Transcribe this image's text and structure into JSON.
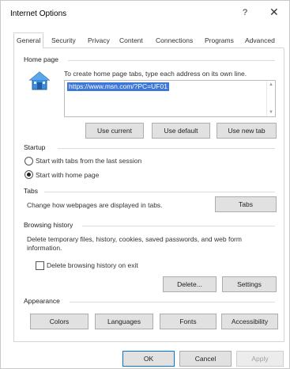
{
  "window": {
    "title": "Internet Options",
    "help_glyph": "?",
    "close_glyph": "✕"
  },
  "tabs": [
    {
      "label": "General",
      "active": true
    },
    {
      "label": "Security"
    },
    {
      "label": "Privacy"
    },
    {
      "label": "Content"
    },
    {
      "label": "Connections"
    },
    {
      "label": "Programs"
    },
    {
      "label": "Advanced"
    }
  ],
  "home_page": {
    "group_label": "Home page",
    "description": "To create home page tabs, type each address on its own line.",
    "url_value": "https://www.msn.com/?PC=UF01",
    "use_current": "Use current",
    "use_default": "Use default",
    "use_new_tab": "Use new tab",
    "icon": "home-page-icon"
  },
  "startup": {
    "group_label": "Startup",
    "option_last_session": "Start with tabs from the last session",
    "option_home_page": "Start with home page",
    "selected": "home_page"
  },
  "tabs_group": {
    "group_label": "Tabs",
    "description": "Change how webpages are displayed in tabs.",
    "tabs_button": "Tabs"
  },
  "browsing_history": {
    "group_label": "Browsing history",
    "description": "Delete temporary files, history, cookies, saved passwords, and web form information.",
    "delete_on_exit_label": "Delete browsing history on exit",
    "delete_on_exit_checked": false,
    "delete_button": "Delete...",
    "settings_button": "Settings"
  },
  "appearance": {
    "group_label": "Appearance",
    "colors": "Colors",
    "languages": "Languages",
    "fonts": "Fonts",
    "accessibility": "Accessibility"
  },
  "footer": {
    "ok": "OK",
    "cancel": "Cancel",
    "apply": "Apply"
  }
}
